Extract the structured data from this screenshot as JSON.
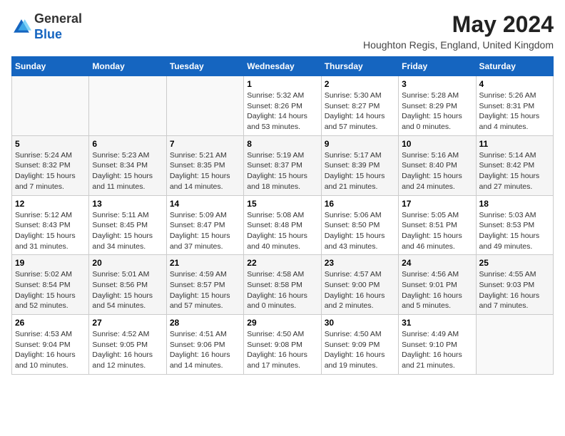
{
  "logo": {
    "general": "General",
    "blue": "Blue"
  },
  "header": {
    "month_year": "May 2024",
    "location": "Houghton Regis, England, United Kingdom"
  },
  "weekdays": [
    "Sunday",
    "Monday",
    "Tuesday",
    "Wednesday",
    "Thursday",
    "Friday",
    "Saturday"
  ],
  "weeks": [
    [
      {
        "day": "",
        "sunrise": "",
        "sunset": "",
        "daylight": ""
      },
      {
        "day": "",
        "sunrise": "",
        "sunset": "",
        "daylight": ""
      },
      {
        "day": "",
        "sunrise": "",
        "sunset": "",
        "daylight": ""
      },
      {
        "day": "1",
        "sunrise": "Sunrise: 5:32 AM",
        "sunset": "Sunset: 8:26 PM",
        "daylight": "Daylight: 14 hours and 53 minutes."
      },
      {
        "day": "2",
        "sunrise": "Sunrise: 5:30 AM",
        "sunset": "Sunset: 8:27 PM",
        "daylight": "Daylight: 14 hours and 57 minutes."
      },
      {
        "day": "3",
        "sunrise": "Sunrise: 5:28 AM",
        "sunset": "Sunset: 8:29 PM",
        "daylight": "Daylight: 15 hours and 0 minutes."
      },
      {
        "day": "4",
        "sunrise": "Sunrise: 5:26 AM",
        "sunset": "Sunset: 8:31 PM",
        "daylight": "Daylight: 15 hours and 4 minutes."
      }
    ],
    [
      {
        "day": "5",
        "sunrise": "Sunrise: 5:24 AM",
        "sunset": "Sunset: 8:32 PM",
        "daylight": "Daylight: 15 hours and 7 minutes."
      },
      {
        "day": "6",
        "sunrise": "Sunrise: 5:23 AM",
        "sunset": "Sunset: 8:34 PM",
        "daylight": "Daylight: 15 hours and 11 minutes."
      },
      {
        "day": "7",
        "sunrise": "Sunrise: 5:21 AM",
        "sunset": "Sunset: 8:35 PM",
        "daylight": "Daylight: 15 hours and 14 minutes."
      },
      {
        "day": "8",
        "sunrise": "Sunrise: 5:19 AM",
        "sunset": "Sunset: 8:37 PM",
        "daylight": "Daylight: 15 hours and 18 minutes."
      },
      {
        "day": "9",
        "sunrise": "Sunrise: 5:17 AM",
        "sunset": "Sunset: 8:39 PM",
        "daylight": "Daylight: 15 hours and 21 minutes."
      },
      {
        "day": "10",
        "sunrise": "Sunrise: 5:16 AM",
        "sunset": "Sunset: 8:40 PM",
        "daylight": "Daylight: 15 hours and 24 minutes."
      },
      {
        "day": "11",
        "sunrise": "Sunrise: 5:14 AM",
        "sunset": "Sunset: 8:42 PM",
        "daylight": "Daylight: 15 hours and 27 minutes."
      }
    ],
    [
      {
        "day": "12",
        "sunrise": "Sunrise: 5:12 AM",
        "sunset": "Sunset: 8:43 PM",
        "daylight": "Daylight: 15 hours and 31 minutes."
      },
      {
        "day": "13",
        "sunrise": "Sunrise: 5:11 AM",
        "sunset": "Sunset: 8:45 PM",
        "daylight": "Daylight: 15 hours and 34 minutes."
      },
      {
        "day": "14",
        "sunrise": "Sunrise: 5:09 AM",
        "sunset": "Sunset: 8:47 PM",
        "daylight": "Daylight: 15 hours and 37 minutes."
      },
      {
        "day": "15",
        "sunrise": "Sunrise: 5:08 AM",
        "sunset": "Sunset: 8:48 PM",
        "daylight": "Daylight: 15 hours and 40 minutes."
      },
      {
        "day": "16",
        "sunrise": "Sunrise: 5:06 AM",
        "sunset": "Sunset: 8:50 PM",
        "daylight": "Daylight: 15 hours and 43 minutes."
      },
      {
        "day": "17",
        "sunrise": "Sunrise: 5:05 AM",
        "sunset": "Sunset: 8:51 PM",
        "daylight": "Daylight: 15 hours and 46 minutes."
      },
      {
        "day": "18",
        "sunrise": "Sunrise: 5:03 AM",
        "sunset": "Sunset: 8:53 PM",
        "daylight": "Daylight: 15 hours and 49 minutes."
      }
    ],
    [
      {
        "day": "19",
        "sunrise": "Sunrise: 5:02 AM",
        "sunset": "Sunset: 8:54 PM",
        "daylight": "Daylight: 15 hours and 52 minutes."
      },
      {
        "day": "20",
        "sunrise": "Sunrise: 5:01 AM",
        "sunset": "Sunset: 8:56 PM",
        "daylight": "Daylight: 15 hours and 54 minutes."
      },
      {
        "day": "21",
        "sunrise": "Sunrise: 4:59 AM",
        "sunset": "Sunset: 8:57 PM",
        "daylight": "Daylight: 15 hours and 57 minutes."
      },
      {
        "day": "22",
        "sunrise": "Sunrise: 4:58 AM",
        "sunset": "Sunset: 8:58 PM",
        "daylight": "Daylight: 16 hours and 0 minutes."
      },
      {
        "day": "23",
        "sunrise": "Sunrise: 4:57 AM",
        "sunset": "Sunset: 9:00 PM",
        "daylight": "Daylight: 16 hours and 2 minutes."
      },
      {
        "day": "24",
        "sunrise": "Sunrise: 4:56 AM",
        "sunset": "Sunset: 9:01 PM",
        "daylight": "Daylight: 16 hours and 5 minutes."
      },
      {
        "day": "25",
        "sunrise": "Sunrise: 4:55 AM",
        "sunset": "Sunset: 9:03 PM",
        "daylight": "Daylight: 16 hours and 7 minutes."
      }
    ],
    [
      {
        "day": "26",
        "sunrise": "Sunrise: 4:53 AM",
        "sunset": "Sunset: 9:04 PM",
        "daylight": "Daylight: 16 hours and 10 minutes."
      },
      {
        "day": "27",
        "sunrise": "Sunrise: 4:52 AM",
        "sunset": "Sunset: 9:05 PM",
        "daylight": "Daylight: 16 hours and 12 minutes."
      },
      {
        "day": "28",
        "sunrise": "Sunrise: 4:51 AM",
        "sunset": "Sunset: 9:06 PM",
        "daylight": "Daylight: 16 hours and 14 minutes."
      },
      {
        "day": "29",
        "sunrise": "Sunrise: 4:50 AM",
        "sunset": "Sunset: 9:08 PM",
        "daylight": "Daylight: 16 hours and 17 minutes."
      },
      {
        "day": "30",
        "sunrise": "Sunrise: 4:50 AM",
        "sunset": "Sunset: 9:09 PM",
        "daylight": "Daylight: 16 hours and 19 minutes."
      },
      {
        "day": "31",
        "sunrise": "Sunrise: 4:49 AM",
        "sunset": "Sunset: 9:10 PM",
        "daylight": "Daylight: 16 hours and 21 minutes."
      },
      {
        "day": "",
        "sunrise": "",
        "sunset": "",
        "daylight": ""
      }
    ]
  ]
}
